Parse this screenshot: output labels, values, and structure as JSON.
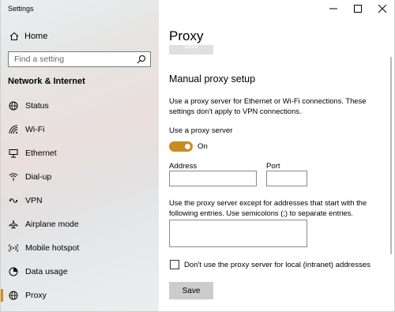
{
  "window": {
    "title": "Settings"
  },
  "sidebar": {
    "home_label": "Home",
    "search_placeholder": "Find a setting",
    "section_title": "Network & Internet",
    "items": [
      {
        "label": "Status",
        "icon": "globe-status-icon"
      },
      {
        "label": "Wi-Fi",
        "icon": "wifi-icon"
      },
      {
        "label": "Ethernet",
        "icon": "ethernet-icon"
      },
      {
        "label": "Dial-up",
        "icon": "dialup-icon"
      },
      {
        "label": "VPN",
        "icon": "vpn-icon"
      },
      {
        "label": "Airplane mode",
        "icon": "airplane-icon"
      },
      {
        "label": "Mobile hotspot",
        "icon": "hotspot-icon"
      },
      {
        "label": "Data usage",
        "icon": "data-usage-icon"
      },
      {
        "label": "Proxy",
        "icon": "globe-proxy-icon",
        "active": true
      }
    ]
  },
  "main": {
    "page_title": "Proxy",
    "top_save_label": "Save",
    "section_heading": "Manual proxy setup",
    "description": "Use a proxy server for Ethernet or Wi-Fi connections. These settings don't apply to VPN connections.",
    "use_proxy_label": "Use a proxy server",
    "toggle_state": "On",
    "address_label": "Address",
    "address_value": "",
    "port_label": "Port",
    "port_value": "",
    "exceptions_description": "Use the proxy server except for addresses that start with the following entries. Use semicolons (;) to separate entries.",
    "exceptions_value": "",
    "local_checkbox_label": "Don't use the proxy server for local (intranet) addresses",
    "local_checkbox_checked": false,
    "save_label": "Save"
  },
  "colors": {
    "accent": "#c88a21",
    "active_indicator": "#d48a1c"
  }
}
